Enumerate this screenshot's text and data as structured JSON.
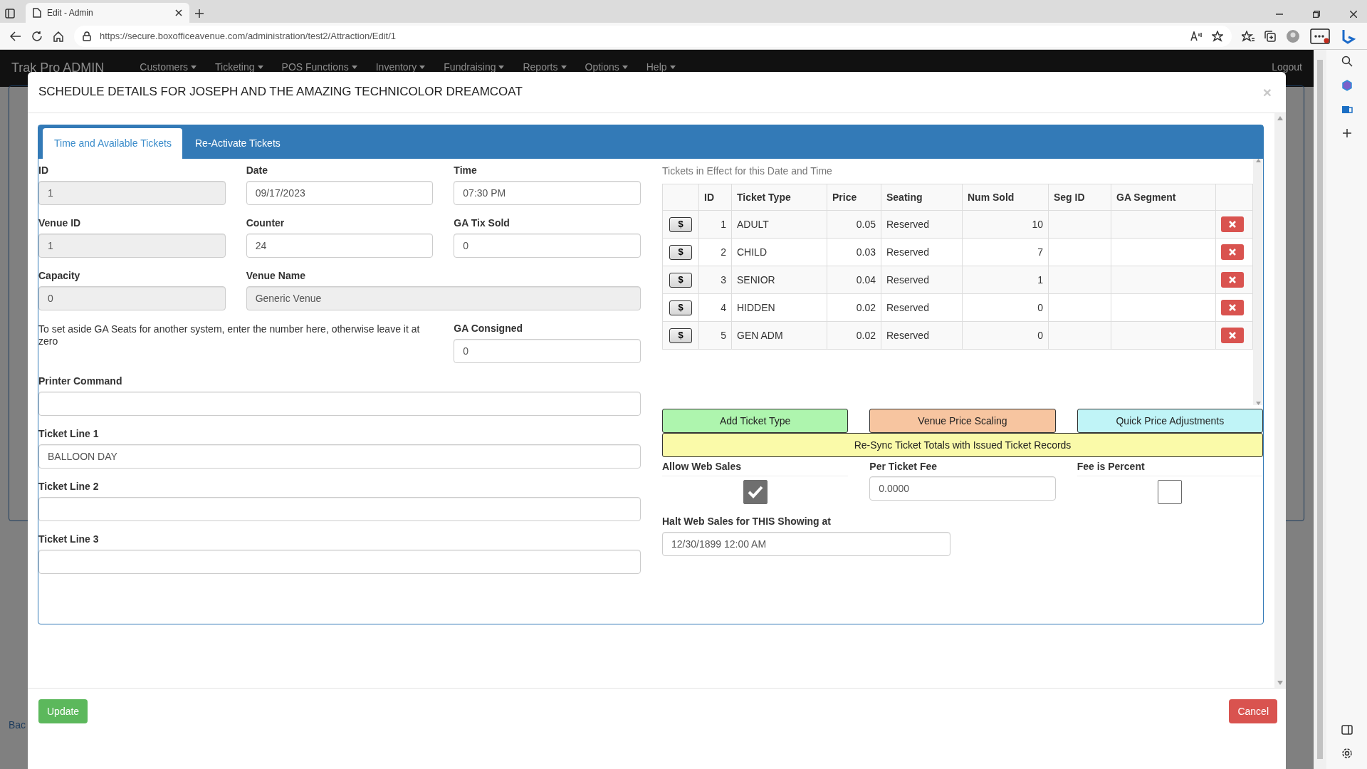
{
  "browser": {
    "tab_title": "Edit - Admin",
    "url": "https://secure.boxofficeavenue.com/administration/test2/Attraction/Edit/1"
  },
  "navbar": {
    "brand": "Trak Pro ADMIN",
    "items": [
      "Customers",
      "Ticketing",
      "POS Functions",
      "Inventory",
      "Fundraising",
      "Reports",
      "Options",
      "Help"
    ],
    "logout": "Logout"
  },
  "background": {
    "link": "Bac"
  },
  "modal": {
    "title": "SCHEDULE DETAILS FOR JOSEPH AND THE AMAZING TECHNICOLOR DREAMCOAT",
    "close": "×",
    "tabs": [
      {
        "label": "Time and Available Tickets",
        "selected": true
      },
      {
        "label": "Re-Activate Tickets",
        "selected": false
      }
    ],
    "form_rows": [
      [
        {
          "kind": "field",
          "label": "ID",
          "value": "1",
          "readonly": true
        },
        {
          "kind": "field",
          "label": "Date",
          "value": "09/17/2023",
          "readonly": false
        },
        {
          "kind": "field",
          "label": "Time",
          "value": "07:30 PM",
          "readonly": false
        }
      ],
      [
        {
          "kind": "field",
          "label": "Venue ID",
          "value": "1",
          "readonly": true
        },
        {
          "kind": "field",
          "label": "Counter",
          "value": "24",
          "readonly": false
        },
        {
          "kind": "field",
          "label": "GA Tix Sold",
          "value": "0",
          "readonly": false
        }
      ],
      [
        {
          "kind": "field",
          "label": "Capacity",
          "value": "0",
          "readonly": true
        },
        {
          "kind": "field",
          "label": "Venue Name",
          "value": "Generic Venue",
          "readonly": true
        }
      ],
      [
        {
          "kind": "note",
          "text": "To set aside GA Seats for another system, enter the number here, otherwise leave it at zero"
        },
        {
          "kind": "field",
          "label": "GA Consigned",
          "value": "0",
          "readonly": false
        }
      ],
      [
        {
          "kind": "field",
          "label": "Printer Command",
          "readonly": false
        }
      ],
      [
        {
          "kind": "field",
          "label": "Ticket Line 1",
          "value": "BALLOON DAY",
          "readonly": false
        }
      ],
      [
        {
          "kind": "field",
          "label": "Ticket Line 2",
          "readonly": false
        }
      ],
      [
        {
          "kind": "field",
          "label": "Ticket Line 3",
          "readonly": false
        }
      ]
    ],
    "tickets": {
      "caption": "Tickets in Effect for this Date and Time",
      "columns": [
        "ID",
        "Ticket Type",
        "Price",
        "Seating",
        "Num Sold",
        "Seg ID",
        "GA Segment"
      ],
      "rows": [
        {
          "price_button": "$",
          "id": "1",
          "ticket_type": "ADULT",
          "price": "0.05",
          "seating": "Reserved",
          "num_sold": "10"
        },
        {
          "price_button": "$",
          "id": "2",
          "ticket_type": "CHILD",
          "price": "0.03",
          "seating": "Reserved",
          "num_sold": "7"
        },
        {
          "price_button": "$",
          "id": "3",
          "ticket_type": "SENIOR",
          "price": "0.04",
          "seating": "Reserved",
          "num_sold": "1"
        },
        {
          "price_button": "$",
          "id": "4",
          "ticket_type": "HIDDEN",
          "price": "0.02",
          "seating": "Reserved",
          "num_sold": "0"
        },
        {
          "price_button": "$",
          "id": "5",
          "ticket_type": "GEN ADM",
          "price": "0.02",
          "seating": "Reserved",
          "num_sold": "0"
        }
      ]
    },
    "actions": [
      {
        "label": "Add Ticket Type",
        "color": "#aef5ae"
      },
      {
        "label": "Venue Price Scaling",
        "color": "#f7c5a0"
      },
      {
        "label": "Quick Price Adjustments",
        "color": "#c0f4f7"
      }
    ],
    "resync": {
      "label": "Re-Sync Ticket Totals with Issued Ticket Records",
      "color": "#fafaa9"
    },
    "web_sales": {
      "allow_label": "Allow Web Sales",
      "allow_checked": true,
      "fee_label": "Per Ticket Fee",
      "fee_value": "0.0000",
      "percent_label": "Fee is Percent",
      "percent_checked": false,
      "halt_label": "Halt Web Sales for THIS Showing at",
      "halt_value": "12/30/1899 12:00 AM"
    },
    "footer": {
      "update": "Update",
      "cancel": "Cancel"
    }
  }
}
